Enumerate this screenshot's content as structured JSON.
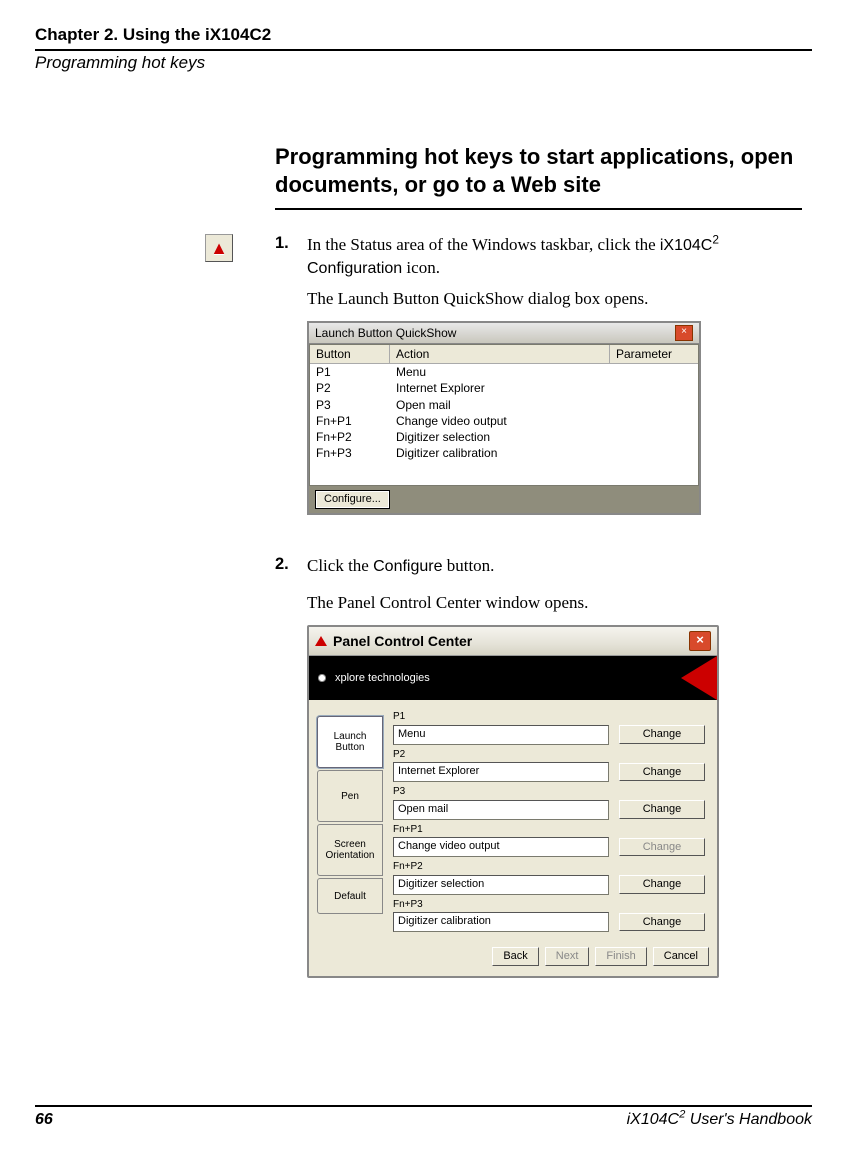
{
  "header": {
    "chapter": "Chapter 2. Using the iX104C2",
    "subtitle": "Programming hot keys"
  },
  "section_title": "Programming hot keys to start applications, open documents, or go to a Web site",
  "step1": {
    "num": "1.",
    "line1a": "In the Status area of the Windows taskbar, click the ",
    "line1b_device": "iX104C",
    "line1b_sup": "2",
    "line1c": "Configuration",
    "line1d": " icon.",
    "line2": "The Launch Button QuickShow dialog box opens."
  },
  "step2": {
    "num": "2.",
    "line1a": "Click the ",
    "line1b": "Configure",
    "line1c": " button.",
    "line2": "The Panel Control Center window opens."
  },
  "quickshow": {
    "title": "Launch Button QuickShow",
    "cols": {
      "button": "Button",
      "action": "Action",
      "parameter": "Parameter"
    },
    "rows": [
      {
        "b": "P1",
        "a": "Menu"
      },
      {
        "b": "P2",
        "a": "Internet Explorer"
      },
      {
        "b": "P3",
        "a": "Open mail"
      },
      {
        "b": "Fn+P1",
        "a": "Change video output"
      },
      {
        "b": "Fn+P2",
        "a": "Digitizer selection"
      },
      {
        "b": "Fn+P3",
        "a": "Digitizer calibration"
      }
    ],
    "configure_btn": "Configure..."
  },
  "pcc": {
    "title": "Panel Control Center",
    "brand": "xplore technologies",
    "tabs": {
      "launch": "Launch\nButton",
      "pen": "Pen",
      "screen": "Screen\nOrientation",
      "default": "Default"
    },
    "fields": [
      {
        "label": "P1",
        "value": "Menu",
        "change_enabled": true
      },
      {
        "label": "P2",
        "value": "Internet Explorer",
        "change_enabled": true
      },
      {
        "label": "P3",
        "value": "Open mail",
        "change_enabled": true
      },
      {
        "label": "Fn+P1",
        "value": "Change video output",
        "change_enabled": false
      },
      {
        "label": "Fn+P2",
        "value": "Digitizer selection",
        "change_enabled": true
      },
      {
        "label": "Fn+P3",
        "value": "Digitizer calibration",
        "change_enabled": true
      }
    ],
    "change_btn": "Change",
    "footer": {
      "back": "Back",
      "next": "Next",
      "finish": "Finish",
      "cancel": "Cancel"
    }
  },
  "footer": {
    "page": "66",
    "book_a": "iX104C",
    "book_sup": "2",
    "book_b": " User's Handbook"
  }
}
